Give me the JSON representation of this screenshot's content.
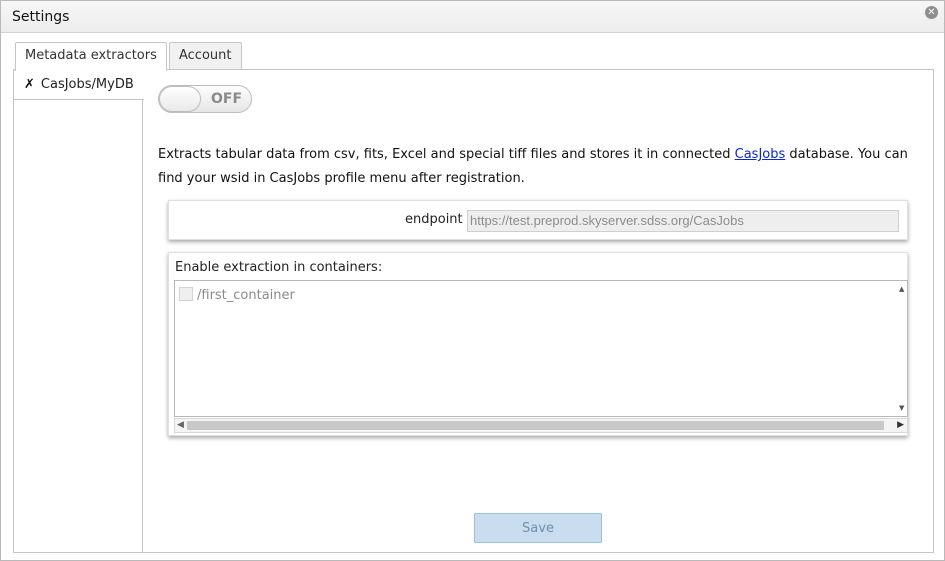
{
  "window": {
    "title": "Settings",
    "close_icon": "close-icon"
  },
  "tabs": [
    {
      "label": "Metadata extractors",
      "active": true
    },
    {
      "label": "Account",
      "active": false
    }
  ],
  "sidebar": {
    "items": [
      {
        "label": "CasJobs/MyDB",
        "mark": "✗"
      }
    ]
  },
  "toggle": {
    "state_label": "OFF",
    "on": false
  },
  "description": {
    "before_link": "Extracts tabular data from csv, fits, Excel and special tiff files and stores it in connected ",
    "link": "CasJobs",
    "after_link": " database. You can find your wsid in CasJobs profile menu after registration."
  },
  "endpoint": {
    "label": "endpoint",
    "value": "https://test.preprod.skyserver.sdss.org/CasJobs"
  },
  "containers": {
    "label": "Enable extraction in containers:",
    "items": [
      {
        "name": "/first_container",
        "checked": false
      }
    ]
  },
  "save_button": {
    "label": "Save"
  },
  "colors": {
    "link": "#0b28c8",
    "save_bg": "#c9ddf0",
    "save_text": "#6e8fb0"
  }
}
